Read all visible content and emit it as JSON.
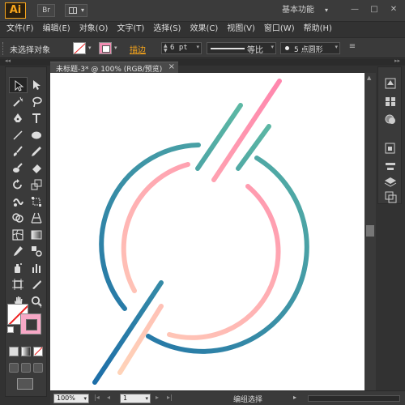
{
  "app": {
    "logo": "Ai",
    "bridge_label": "Br"
  },
  "workspace": {
    "label": "基本功能"
  },
  "window_controls": {
    "minimize": "—",
    "maximize": "□",
    "close": "✕"
  },
  "menu": [
    "文件(F)",
    "编辑(E)",
    "对象(O)",
    "文字(T)",
    "选择(S)",
    "效果(C)",
    "视图(V)",
    "窗口(W)",
    "帮助(H)"
  ],
  "control_bar": {
    "selection_status": "未选择对象",
    "stroke_label": "描边",
    "stroke_weight": "6 pt",
    "line_style": "等比",
    "brush": "5 点圆形",
    "colors": {
      "stroke": "#f28eb3",
      "fill": "none"
    }
  },
  "document": {
    "tab_title": "未标题-3* @ 100% (RGB/预览)",
    "close": "×"
  },
  "status_bar": {
    "zoom": "100%",
    "page": "1",
    "tool_status": "编组选择"
  },
  "artwork": {
    "gradient_dark_stops": [
      "#1d6ea8",
      "#5db8a4"
    ],
    "gradient_light_stops": [
      "#ffd3b8",
      "#ff86ad"
    ]
  },
  "tools": [
    [
      "selection-tool",
      "direct-selection-tool"
    ],
    [
      "magic-wand-tool",
      "lasso-tool"
    ],
    [
      "pen-tool",
      "type-tool"
    ],
    [
      "line-segment-tool",
      "ellipse-tool"
    ],
    [
      "paintbrush-tool",
      "pencil-tool"
    ],
    [
      "blob-brush-tool",
      "eraser-tool"
    ],
    [
      "rotate-tool",
      "scale-tool"
    ],
    [
      "warp-tool",
      "free-transform-tool"
    ],
    [
      "shape-builder-tool",
      "perspective-grid-tool"
    ],
    [
      "mesh-tool",
      "gradient-tool"
    ],
    [
      "eyedropper-tool",
      "blend-tool"
    ],
    [
      "symbol-sprayer-tool",
      "column-graph-tool"
    ],
    [
      "artboard-tool",
      "slice-tool"
    ],
    [
      "hand-tool",
      "zoom-tool"
    ]
  ]
}
